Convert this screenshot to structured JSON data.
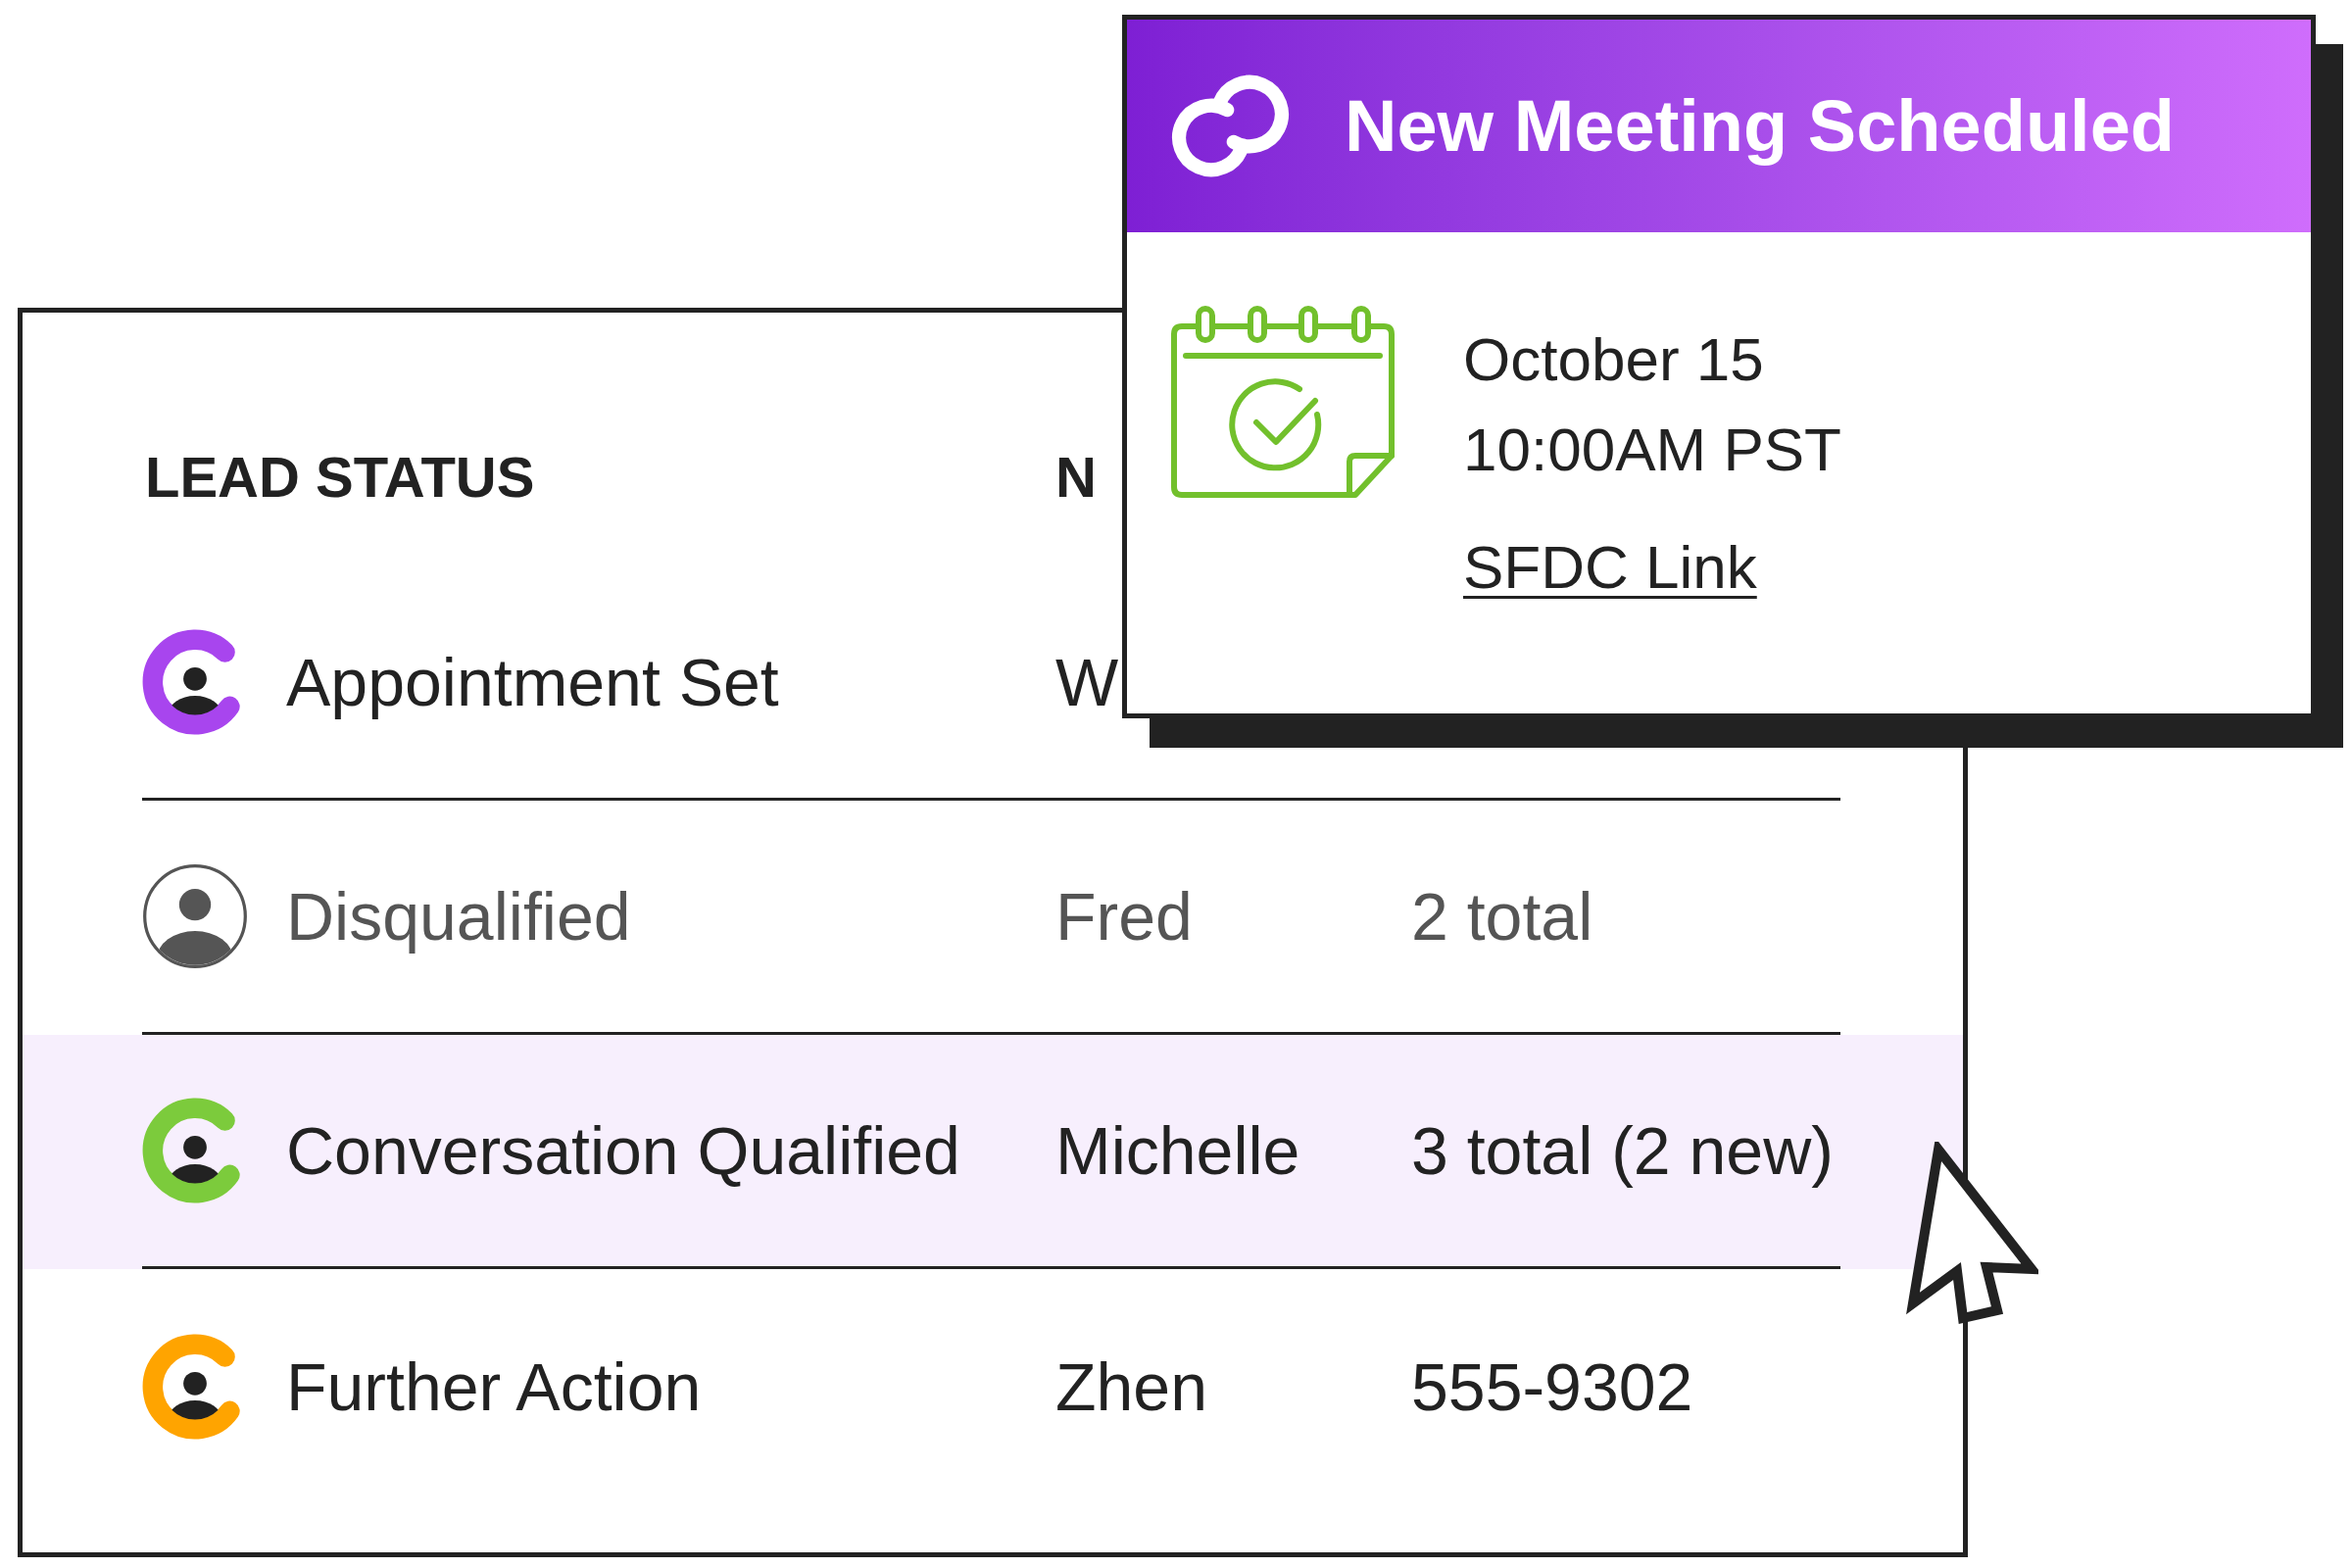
{
  "notification": {
    "title": "New Meeting Scheduled",
    "date": "October 15",
    "time": "10:00AM PST",
    "link": "SFDC Link"
  },
  "table": {
    "columns": [
      "LEAD STATUS",
      "N"
    ],
    "rows": [
      {
        "status": "Appointment Set",
        "color": "#a845ee",
        "disabled": false,
        "selected": false,
        "name": "W"
      },
      {
        "status": "Disqualified",
        "color": "#555555",
        "disabled": true,
        "selected": false,
        "name": "Fred",
        "column_3": "2 total"
      },
      {
        "status": "Conversation Qualified",
        "color": "#7ccb3c",
        "disabled": false,
        "selected": true,
        "name": "Michelle",
        "column_3": "3 total (2 new)"
      },
      {
        "status": "Further Action",
        "color": "#ffa400",
        "disabled": false,
        "selected": false,
        "name": "Zhen",
        "column_3": "555-9302"
      }
    ]
  }
}
